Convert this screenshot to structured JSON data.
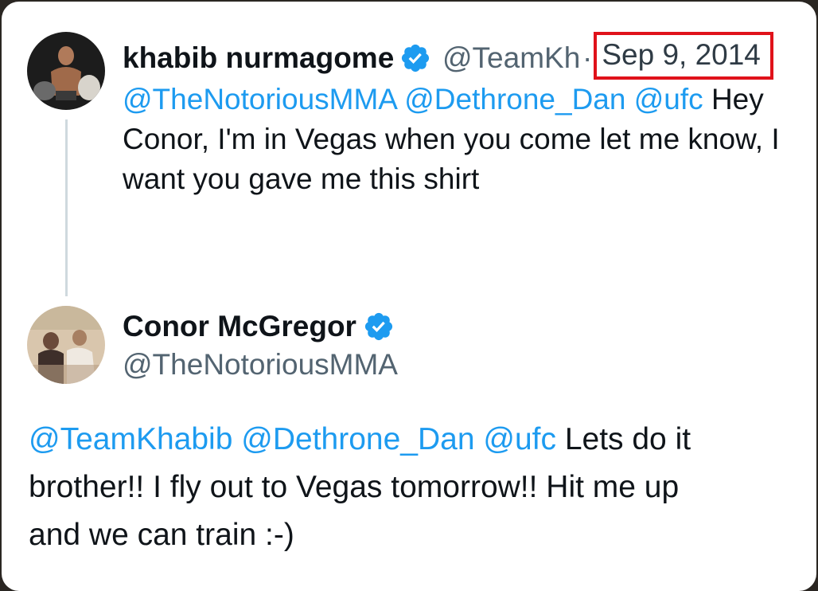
{
  "first_tweet": {
    "avatar_icon": "user-avatar-icon",
    "display_name": "khabib nurmagome",
    "verified_icon": "verified-badge-icon",
    "handle": "@TeamKh",
    "separator": "·",
    "date": "Sep 9, 2014",
    "highlight_color": "#e0121a",
    "mentions": [
      "@TheNotoriousMMA",
      "@Dethrone_Dan",
      "@ufc"
    ],
    "text_line1_tail": " Hey",
    "text_line2": "Conor, I'm in Vegas when you come let me know, I",
    "text_line3": "want you gave me this shirt"
  },
  "reply_tweet": {
    "avatar_icon": "user-avatar-icon",
    "display_name": "Conor McGregor",
    "verified_icon": "verified-badge-icon",
    "handle": "@TheNotoriousMMA",
    "mentions": [
      "@TeamKhabib",
      "@Dethrone_Dan",
      "@ufc"
    ],
    "text_line1_tail": " Lets do it",
    "text_line2": "brother!! I fly out to Vegas tomorrow!! Hit me up",
    "text_line3": "and we can train :-)"
  },
  "colors": {
    "link": "#1d9bf0",
    "verified": "#1d9bf0",
    "secondary_text": "#536471",
    "thread_line": "#cfd9de"
  }
}
